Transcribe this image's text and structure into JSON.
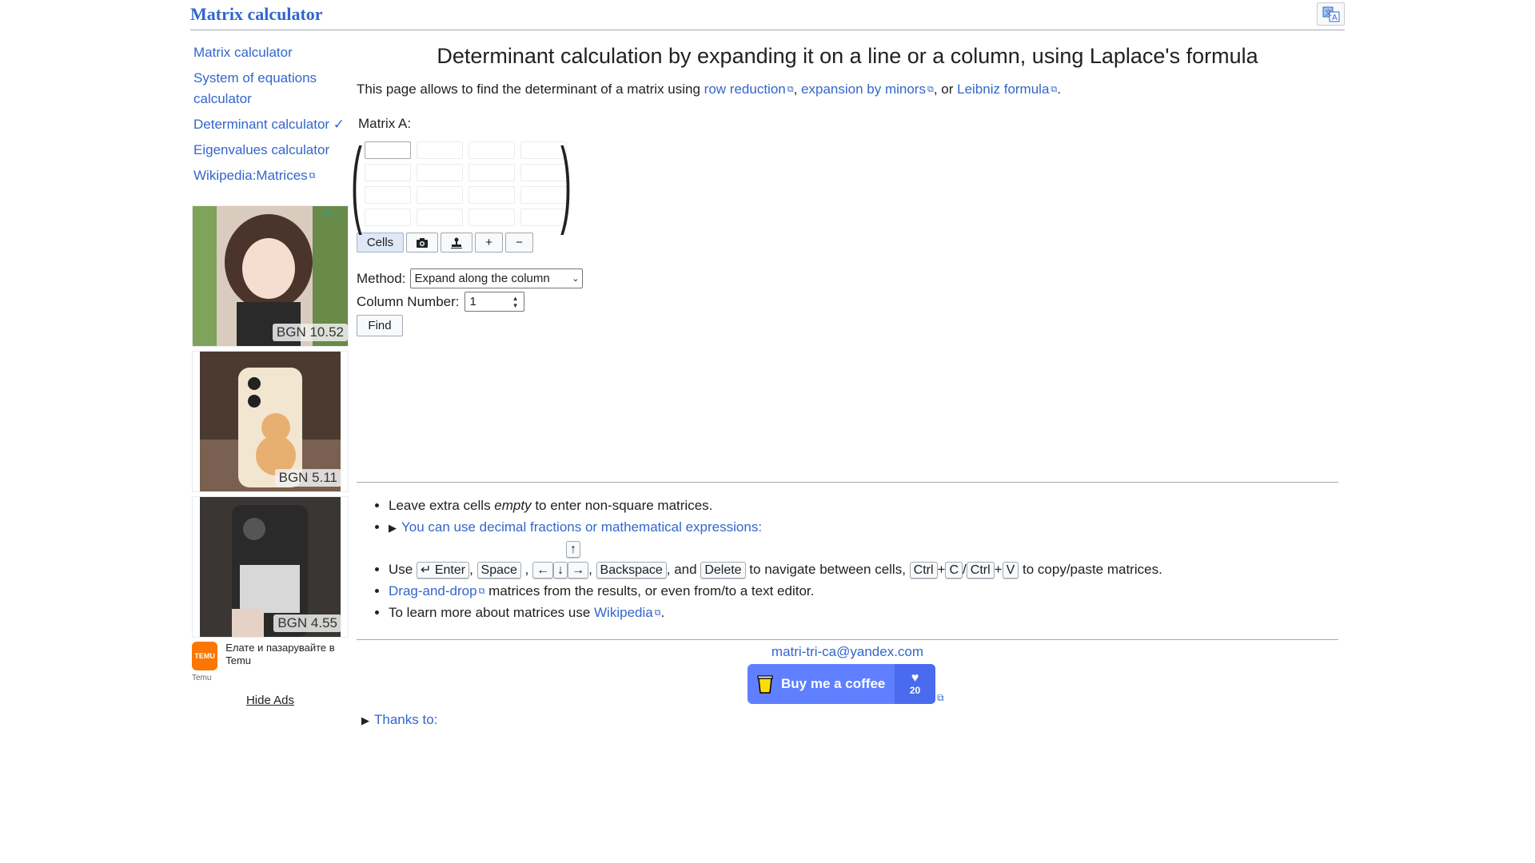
{
  "header": {
    "site_title": "Matrix calculator",
    "translate_icon": "translate-icon"
  },
  "sidebar": {
    "items": [
      {
        "label": "Matrix calculator"
      },
      {
        "label": "System of equations calculator"
      },
      {
        "label": "Determinant calculator ✓"
      },
      {
        "label": "Eigenvalues calculator"
      },
      {
        "label": "Wikipedia:Matrices",
        "external": true
      }
    ]
  },
  "ads": {
    "cards": [
      {
        "price": "BGN 10.52"
      },
      {
        "price": "BGN 5.11"
      },
      {
        "price": "BGN 4.55"
      }
    ],
    "temu_logo": "TEMU",
    "temu_text": "Елате и пазарувайте в Temu",
    "temu_label": "Temu",
    "hide_ads": "Hide Ads"
  },
  "main": {
    "title": "Determinant calculation by expanding it on a line or a column, using Laplace's formula",
    "intro_prefix": "This page allows to find the determinant of a matrix using ",
    "link_row_reduction": "row reduction",
    "link_expansion": "expansion by minors",
    "link_leibniz": "Leibniz formula",
    "sep1": ", ",
    "sep2": ", or ",
    "end": ".",
    "matrix_label": "Matrix A:",
    "matrix_rows": 4,
    "matrix_cols": 4,
    "toolbar": {
      "cells": "Cells",
      "camera_icon": "camera-icon",
      "stamp_icon": "stamp-icon",
      "plus": "+",
      "minus": "−"
    },
    "method_label": "Method:",
    "method_value": "Expand along the column",
    "column_label": "Column Number:",
    "column_value": "1",
    "find": "Find"
  },
  "help": {
    "item1_a": "Leave extra cells ",
    "item1_em": "empty",
    "item1_b": " to enter non-square matrices.",
    "item2": "You can use decimal fractions or mathematical expressions:",
    "nav_use": "Use ",
    "key_enter": "↵ Enter",
    "key_space": "Space",
    "key_left": "←",
    "key_down": "↓",
    "key_right": "→",
    "key_up": "↑",
    "key_backspace": "Backspace",
    "and": ", and ",
    "key_delete": "Delete",
    "nav_mid": " to navigate between cells, ",
    "key_ctrl": "Ctrl",
    "key_c": "C",
    "key_v": "V",
    "nav_end": " to copy/paste matrices.",
    "drag_link": "Drag-and-drop",
    "drag_rest": " matrices from the results, or even from/to a text editor.",
    "learn_prefix": "To learn more about matrices use ",
    "wiki_link": "Wikipedia",
    "learn_end": "."
  },
  "footer": {
    "email": "matri-tri-ca@yandex.com",
    "coffee_label": "Buy me a coffee",
    "coffee_count": "20",
    "thanks": "Thanks to:"
  },
  "colors": {
    "link": "#3366cc",
    "coffee": "#5f7fff"
  }
}
